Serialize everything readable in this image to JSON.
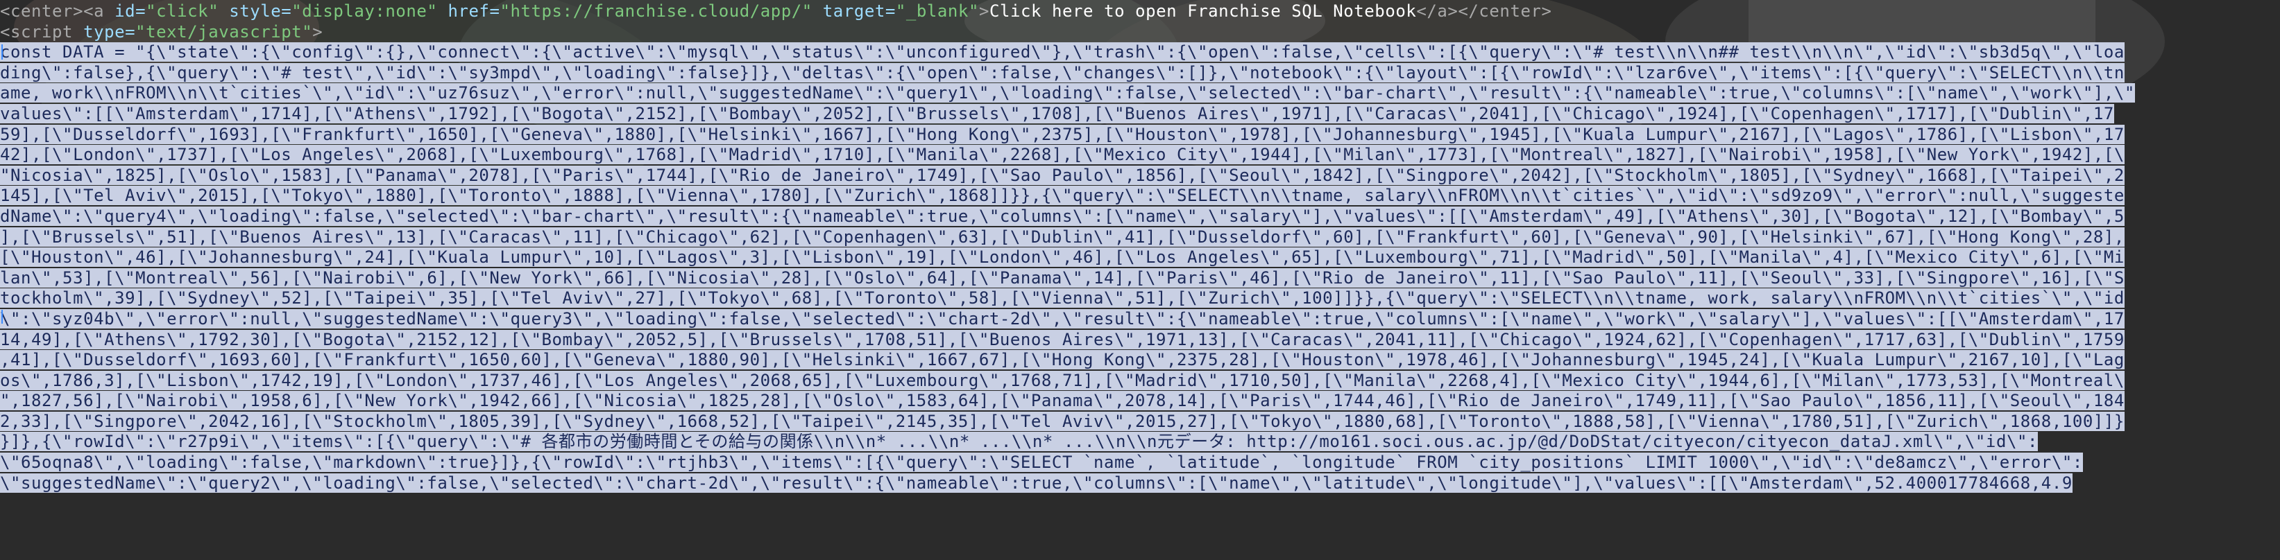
{
  "source_view": {
    "lines": [
      {
        "parts": [
          {
            "text": "<center><a ",
            "style": "tag"
          },
          {
            "text": "id=",
            "style": "attr-name"
          },
          {
            "text": "\"click\"",
            "style": "attr-value"
          },
          {
            "text": " ",
            "style": "tag"
          },
          {
            "text": "style=",
            "style": "attr-name"
          },
          {
            "text": "\"display:none\"",
            "style": "attr-value"
          },
          {
            "text": " ",
            "style": "tag"
          },
          {
            "text": "href=",
            "style": "attr-name"
          },
          {
            "text": "\"https://franchise.cloud/app/\"",
            "style": "attr-value"
          },
          {
            "text": " ",
            "style": "tag"
          },
          {
            "text": "target=",
            "style": "attr-name"
          },
          {
            "text": "\"_blank\"",
            "style": "attr-value"
          },
          {
            "text": ">",
            "style": "tag"
          },
          {
            "text": "Click here to open Franchise SQL Notebook",
            "style": "link-text"
          },
          {
            "text": "</a></center>",
            "style": "tag"
          }
        ]
      },
      {
        "parts": [
          {
            "text": "<script ",
            "style": "tag"
          },
          {
            "text": "type=",
            "style": "attr-name"
          },
          {
            "text": "\"text/javascript\"",
            "style": "attr-value"
          },
          {
            "text": ">",
            "style": "tag"
          }
        ]
      },
      {
        "parts": [
          {
            "text": "const DATA = \"{\\\"state\\\":{\\\"config\\\":{},\\\"connect\\\":{\\\"active\\\":\\\"mysql\\\",\\\"status\\\":\\\"unconfigured\\\"},\\\"trash\\\":{\\\"open\\\":false,\\\"cells\\\":[{\\\"query\\\":\\\"# test\\\\n\\\\n## test\\\\n\\\\n\\\",\\\"id\\\":\\\"sb3d5q\\\",\\\"loa",
            "style": "sel"
          }
        ]
      },
      {
        "parts": [
          {
            "text": "ding\\\":false},{\\\"query\\\":\\\"# test\\\",\\\"id\\\":\\\"sy3mpd\\\",\\\"loading\\\":false}]},\\\"deltas\\\":{\\\"open\\\":false,\\\"changes\\\":[]},\\\"notebook\\\":{\\\"layout\\\":[{\\\"rowId\\\":\\\"lzar6ve\\\",\\\"items\\\":[{\\\"query\\\":\\\"SELECT\\\\n\\\\tn",
            "style": "sel"
          }
        ]
      },
      {
        "parts": [
          {
            "text": "ame, work\\\\nFROM\\\\n\\\\t`cities`\\\",\\\"id\\\":\\\"uz76suz\\\",\\\"error\\\":null,\\\"suggestedName\\\":\\\"query1\\\",\\\"loading\\\":false,\\\"selected\\\":\\\"bar-chart\\\",\\\"result\\\":{\\\"nameable\\\":true,\\\"columns\\\":[\\\"name\\\",\\\"work\\\"],\\\"",
            "style": "sel"
          }
        ]
      },
      {
        "parts": [
          {
            "text": "values\\\":[[\\\"Amsterdam\\\",1714],[\\\"Athens\\\",1792],[\\\"Bogota\\\",2152],[\\\"Bombay\\\",2052],[\\\"Brussels\\\",1708],[\\\"Buenos Aires\\\",1971],[\\\"Caracas\\\",2041],[\\\"Chicago\\\",1924],[\\\"Copenhagen\\\",1717],[\\\"Dublin\\\",17",
            "style": "sel"
          }
        ]
      },
      {
        "parts": [
          {
            "text": "59],[\\\"Dusseldorf\\\",1693],[\\\"Frankfurt\\\",1650],[\\\"Geneva\\\",1880],[\\\"Helsinki\\\",1667],[\\\"Hong Kong\\\",2375],[\\\"Houston\\\",1978],[\\\"Johannesburg\\\",1945],[\\\"Kuala Lumpur\\\",2167],[\\\"Lagos\\\",1786],[\\\"Lisbon\\\",17",
            "style": "sel"
          }
        ]
      },
      {
        "parts": [
          {
            "text": "42],[\\\"London\\\",1737],[\\\"Los Angeles\\\",2068],[\\\"Luxembourg\\\",1768],[\\\"Madrid\\\",1710],[\\\"Manila\\\",2268],[\\\"Mexico City\\\",1944],[\\\"Milan\\\",1773],[\\\"Montreal\\\",1827],[\\\"Nairobi\\\",1958],[\\\"New York\\\",1942],[\\",
            "style": "sel"
          }
        ]
      },
      {
        "parts": [
          {
            "text": "\"Nicosia\\\",1825],[\\\"Oslo\\\",1583],[\\\"Panama\\\",2078],[\\\"Paris\\\",1744],[\\\"Rio de Janeiro\\\",1749],[\\\"Sao Paulo\\\",1856],[\\\"Seoul\\\",1842],[\\\"Singpore\\\",2042],[\\\"Stockholm\\\",1805],[\\\"Sydney\\\",1668],[\\\"Taipei\\\",2",
            "style": "sel"
          }
        ]
      },
      {
        "parts": [
          {
            "text": "145],[\\\"Tel Aviv\\\",2015],[\\\"Tokyo\\\",1880],[\\\"Toronto\\\",1888],[\\\"Vienna\\\",1780],[\\\"Zurich\\\",1868]]}},{\\\"query\\\":\\\"SELECT\\\\n\\\\tname, salary\\\\nFROM\\\\n\\\\t`cities`\\\",\\\"id\\\":\\\"sd9zo9\\\",\\\"error\\\":null,\\\"suggeste",
            "style": "sel"
          }
        ]
      },
      {
        "parts": [
          {
            "text": "dName\\\":\\\"query4\\\",\\\"loading\\\":false,\\\"selected\\\":\\\"bar-chart\\\",\\\"result\\\":{\\\"nameable\\\":true,\\\"columns\\\":[\\\"name\\\",\\\"salary\\\"],\\\"values\\\":[[\\\"Amsterdam\\\",49],[\\\"Athens\\\",30],[\\\"Bogota\\\",12],[\\\"Bombay\\\",5",
            "style": "sel"
          }
        ]
      },
      {
        "parts": [
          {
            "text": "],[\\\"Brussels\\\",51],[\\\"Buenos Aires\\\",13],[\\\"Caracas\\\",11],[\\\"Chicago\\\",62],[\\\"Copenhagen\\\",63],[\\\"Dublin\\\",41],[\\\"Dusseldorf\\\",60],[\\\"Frankfurt\\\",60],[\\\"Geneva\\\",90],[\\\"Helsinki\\\",67],[\\\"Hong Kong\\\",28],",
            "style": "sel"
          }
        ]
      },
      {
        "parts": [
          {
            "text": "[\\\"Houston\\\",46],[\\\"Johannesburg\\\",24],[\\\"Kuala Lumpur\\\",10],[\\\"Lagos\\\",3],[\\\"Lisbon\\\",19],[\\\"London\\\",46],[\\\"Los Angeles\\\",65],[\\\"Luxembourg\\\",71],[\\\"Madrid\\\",50],[\\\"Manila\\\",4],[\\\"Mexico City\\\",6],[\\\"Mi",
            "style": "sel"
          }
        ]
      },
      {
        "parts": [
          {
            "text": "lan\\\",53],[\\\"Montreal\\\",56],[\\\"Nairobi\\\",6],[\\\"New York\\\",66],[\\\"Nicosia\\\",28],[\\\"Oslo\\\",64],[\\\"Panama\\\",14],[\\\"Paris\\\",46],[\\\"Rio de Janeiro\\\",11],[\\\"Sao Paulo\\\",11],[\\\"Seoul\\\",33],[\\\"Singpore\\\",16],[\\\"S",
            "style": "sel"
          }
        ]
      },
      {
        "parts": [
          {
            "text": "tockholm\\\",39],[\\\"Sydney\\\",52],[\\\"Taipei\\\",35],[\\\"Tel Aviv\\\",27],[\\\"Tokyo\\\",68],[\\\"Toronto\\\",58],[\\\"Vienna\\\",51],[\\\"Zurich\\\",100]]}},{\\\"query\\\":\\\"SELECT\\\\n\\\\tname, work, salary\\\\nFROM\\\\n\\\\t`cities`\\\",\\\"id",
            "style": "sel"
          }
        ]
      },
      {
        "parts": [
          {
            "text": "\\\":\\\"syz04b\\\",\\\"error\\\":null,\\\"suggestedName\\\":\\\"query3\\\",\\\"loading\\\":false,\\\"selected\\\":\\\"chart-2d\\\",\\\"result\\\":{\\\"nameable\\\":true,\\\"columns\\\":[\\\"name\\\",\\\"work\\\",\\\"salary\\\"],\\\"values\\\":[[\\\"Amsterdam\\\",17",
            "style": "sel"
          }
        ]
      },
      {
        "parts": [
          {
            "text": "14,49],[\\\"Athens\\\",1792,30],[\\\"Bogota\\\",2152,12],[\\\"Bombay\\\",2052,5],[\\\"Brussels\\\",1708,51],[\\\"Buenos Aires\\\",1971,13],[\\\"Caracas\\\",2041,11],[\\\"Chicago\\\",1924,62],[\\\"Copenhagen\\\",1717,63],[\\\"Dublin\\\",1759",
            "style": "sel"
          }
        ]
      },
      {
        "parts": [
          {
            "text": ",41],[\\\"Dusseldorf\\\",1693,60],[\\\"Frankfurt\\\",1650,60],[\\\"Geneva\\\",1880,90],[\\\"Helsinki\\\",1667,67],[\\\"Hong Kong\\\",2375,28],[\\\"Houston\\\",1978,46],[\\\"Johannesburg\\\",1945,24],[\\\"Kuala Lumpur\\\",2167,10],[\\\"Lag",
            "style": "sel"
          }
        ]
      },
      {
        "parts": [
          {
            "text": "os\\\",1786,3],[\\\"Lisbon\\\",1742,19],[\\\"London\\\",1737,46],[\\\"Los Angeles\\\",2068,65],[\\\"Luxembourg\\\",1768,71],[\\\"Madrid\\\",1710,50],[\\\"Manila\\\",2268,4],[\\\"Mexico City\\\",1944,6],[\\\"Milan\\\",1773,53],[\\\"Montreal\\",
            "style": "sel"
          }
        ]
      },
      {
        "parts": [
          {
            "text": "\",1827,56],[\\\"Nairobi\\\",1958,6],[\\\"New York\\\",1942,66],[\\\"Nicosia\\\",1825,28],[\\\"Oslo\\\",1583,64],[\\\"Panama\\\",2078,14],[\\\"Paris\\\",1744,46],[\\\"Rio de Janeiro\\\",1749,11],[\\\"Sao Paulo\\\",1856,11],[\\\"Seoul\\\",184",
            "style": "sel"
          }
        ]
      },
      {
        "parts": [
          {
            "text": "2,33],[\\\"Singpore\\\",2042,16],[\\\"Stockholm\\\",1805,39],[\\\"Sydney\\\",1668,52],[\\\"Taipei\\\",2145,35],[\\\"Tel Aviv\\\",2015,27],[\\\"Tokyo\\\",1880,68],[\\\"Toronto\\\",1888,58],[\\\"Vienna\\\",1780,51],[\\\"Zurich\\\",1868,100]]}",
            "style": "sel"
          }
        ]
      },
      {
        "parts": [
          {
            "text": "}]},{\\\"rowId\\\":\\\"r27p9i\\\",\\\"items\\\":[{\\\"query\\\":\\\"# 各都市の労働時間とその給与の関係\\\\n\\\\n* ...\\\\n* ...\\\\n* ...\\\\n\\\\n元データ: http://mo161.soci.ous.ac.jp/@d/DoDStat/cityecon/cityecon_dataJ.xml\\\",\\\"id\\\":",
            "style": "sel"
          }
        ]
      },
      {
        "parts": [
          {
            "text": "\\\"65oqna8\\\",\\\"loading\\\":false,\\\"markdown\\\":true}]},{\\\"rowId\\\":\\\"rtjhb3\\\",\\\"items\\\":[{\\\"query\\\":\\\"SELECT `name`, `latitude`, `longitude` FROM `city_positions` LIMIT 1000\\\",\\\"id\\\":\\\"de8amcz\\\",\\\"error\\\":",
            "style": "sel"
          }
        ]
      },
      {
        "parts": [
          {
            "text": "\\\"suggestedName\\\":\\\"query2\\\",\\\"loading\\\":false,\\\"selected\\\":\\\"chart-2d\\\",\\\"result\\\":{\\\"nameable\\\":true,\\\"columns\\\":[\\\"name\\\",\\\"latitude\\\",\\\"longitude\\\"],\\\"values\\\":[[\\\"Amsterdam\\\",52.400017784668,4.9",
            "style": "sel"
          }
        ]
      }
    ]
  },
  "overlay_colors": {
    "selection_bg": "#c9d0e4",
    "selection_text": "#1c2a5a",
    "caret": "#3c8cff"
  }
}
